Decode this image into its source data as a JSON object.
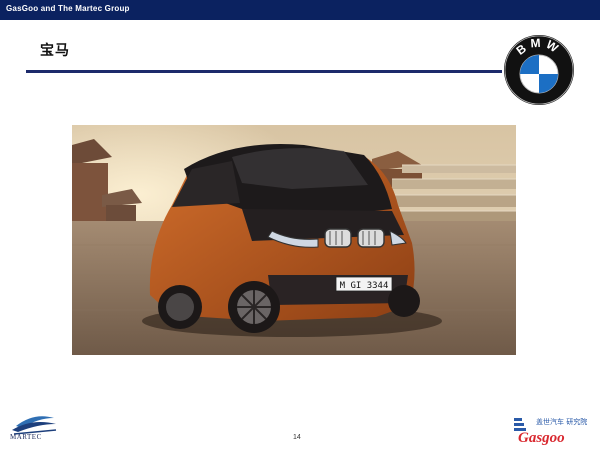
{
  "header": {
    "brand_line": "GasGoo and The Martec Group"
  },
  "slide": {
    "title": "宝马",
    "page_number": "14"
  },
  "logos": {
    "bmw": {
      "letters": "BMW",
      "ring_color": "#111111",
      "blue": "#1c6fc4"
    },
    "martec": {
      "name": "MARTEC"
    },
    "gasgoo": {
      "name": "Gasgoo",
      "chinese": "盖世汽车 研究院"
    }
  },
  "photo": {
    "license_plate": "M GI 3344"
  },
  "colors": {
    "header_bg": "#0b2260",
    "rule": "#1c2a6b",
    "car_body": "#b5571d"
  }
}
